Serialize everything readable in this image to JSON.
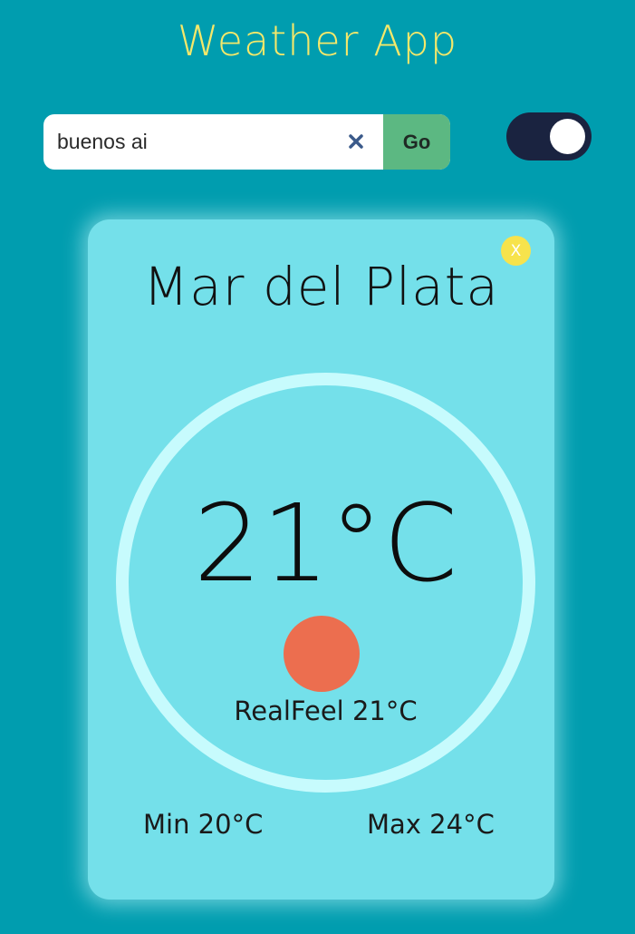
{
  "app": {
    "title": "Weather App"
  },
  "search": {
    "value": "buenos ai",
    "clear_icon": "close-icon",
    "go_label": "Go"
  },
  "theme_toggle": {
    "state": "on"
  },
  "card": {
    "close_label": "X",
    "city": "Mar del Plata",
    "temperature": "21°C",
    "weather_icon": "sun-icon",
    "realfeel": "RealFeel 21°C",
    "min": "Min 20°C",
    "max": "Max 24°C"
  },
  "colors": {
    "background": "#009daf",
    "title": "#f5e86a",
    "go_button": "#5cb882",
    "toggle_track": "#1a2340",
    "card": "#74e0ea",
    "ring": "#c7fbfd",
    "sun": "#ec6e4f",
    "close_badge": "#f7e34c"
  }
}
